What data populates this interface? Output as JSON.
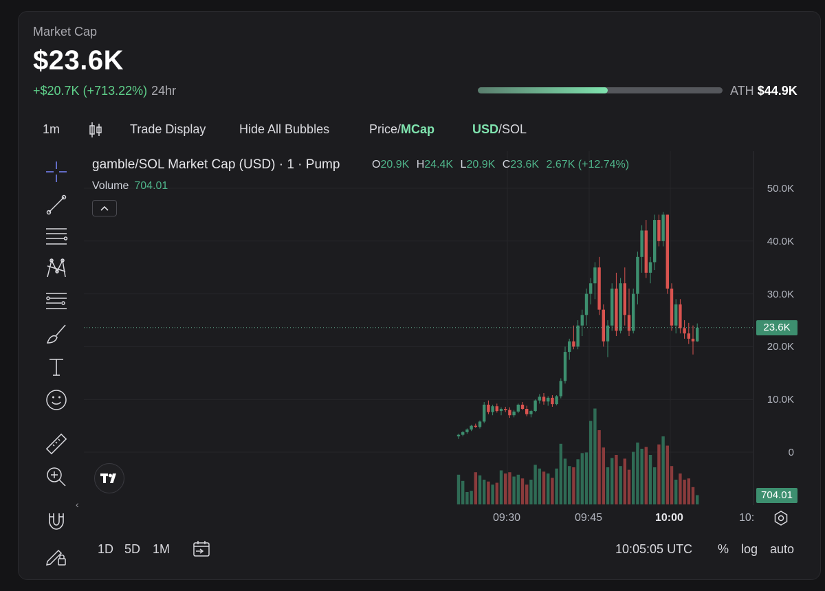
{
  "header": {
    "label": "Market Cap",
    "value": "$23.6K",
    "change": "+$20.7K (+713.22%)",
    "period": "24hr",
    "ath_label": "ATH",
    "ath_value": "$44.9K",
    "ath_progress": 0.53
  },
  "toolbar": {
    "interval": "1m",
    "trade_display": "Trade Display",
    "hide_bubbles": "Hide All Bubbles",
    "price_label": "Price/",
    "mcap_label": "MCap",
    "usd_label": "USD",
    "sol_label": "/SOL"
  },
  "legend": {
    "title": "gamble/SOL Market Cap (USD) · 1 · Pump",
    "o_key": "O",
    "o": "20.9K",
    "h_key": "H",
    "h": "24.4K",
    "l_key": "L",
    "l": "20.9K",
    "c_key": "C",
    "c": "23.6K",
    "change": "2.67K (+12.74%)",
    "volume_label": "Volume",
    "volume_value": "704.01"
  },
  "price_tag": "23.6K",
  "volume_tag": "704.01",
  "bottom": {
    "ranges": [
      "1D",
      "5D",
      "1M"
    ],
    "time": "10:05:05 UTC",
    "percent": "%",
    "log": "log",
    "auto": "auto"
  },
  "colors": {
    "up": "#3d8f6f",
    "down": "#d9534f",
    "up_vol": "#2f6b55",
    "down_vol": "#8a3b3c",
    "accent": "#7fe3ae"
  },
  "chart_data": {
    "type": "candlestick",
    "y_ticks": [
      "50.0K",
      "40.0K",
      "30.0K",
      "20.0K",
      "10.0K",
      "0"
    ],
    "x_ticks": [
      "09:30",
      "09:45",
      "10:00",
      "10:"
    ],
    "ylim": [
      0,
      50000
    ],
    "candles": [
      {
        "o": 3000,
        "h": 3500,
        "l": 2500,
        "c": 3300
      },
      {
        "o": 3300,
        "h": 4000,
        "l": 3000,
        "c": 3800
      },
      {
        "o": 3800,
        "h": 4500,
        "l": 3500,
        "c": 4300
      },
      {
        "o": 4300,
        "h": 5200,
        "l": 4000,
        "c": 5000
      },
      {
        "o": 5000,
        "h": 5400,
        "l": 4600,
        "c": 4800
      },
      {
        "o": 4800,
        "h": 6000,
        "l": 4500,
        "c": 5800
      },
      {
        "o": 5800,
        "h": 9500,
        "l": 5500,
        "c": 9000
      },
      {
        "o": 9000,
        "h": 9800,
        "l": 7200,
        "c": 7600
      },
      {
        "o": 7600,
        "h": 9000,
        "l": 7000,
        "c": 8700
      },
      {
        "o": 8700,
        "h": 9200,
        "l": 7500,
        "c": 7800
      },
      {
        "o": 7800,
        "h": 8500,
        "l": 7000,
        "c": 8200
      },
      {
        "o": 8200,
        "h": 8600,
        "l": 7600,
        "c": 8000
      },
      {
        "o": 8000,
        "h": 8500,
        "l": 6500,
        "c": 7000
      },
      {
        "o": 7000,
        "h": 8000,
        "l": 6600,
        "c": 7700
      },
      {
        "o": 7700,
        "h": 9200,
        "l": 7400,
        "c": 9000
      },
      {
        "o": 9000,
        "h": 9500,
        "l": 8000,
        "c": 8200
      },
      {
        "o": 8200,
        "h": 8800,
        "l": 6800,
        "c": 7200
      },
      {
        "o": 7200,
        "h": 8000,
        "l": 6600,
        "c": 7800
      },
      {
        "o": 7800,
        "h": 10000,
        "l": 7600,
        "c": 9800
      },
      {
        "o": 9800,
        "h": 11000,
        "l": 9200,
        "c": 10500
      },
      {
        "o": 10500,
        "h": 11200,
        "l": 9000,
        "c": 9600
      },
      {
        "o": 9600,
        "h": 10600,
        "l": 8800,
        "c": 10300
      },
      {
        "o": 10300,
        "h": 10800,
        "l": 8600,
        "c": 9100
      },
      {
        "o": 9100,
        "h": 10800,
        "l": 8900,
        "c": 10600
      },
      {
        "o": 10600,
        "h": 14000,
        "l": 10200,
        "c": 13500
      },
      {
        "o": 13500,
        "h": 20000,
        "l": 13000,
        "c": 19000
      },
      {
        "o": 19000,
        "h": 21500,
        "l": 17500,
        "c": 21000
      },
      {
        "o": 21000,
        "h": 24000,
        "l": 19500,
        "c": 20000
      },
      {
        "o": 20000,
        "h": 25000,
        "l": 19500,
        "c": 24000
      },
      {
        "o": 24000,
        "h": 27000,
        "l": 22000,
        "c": 26000
      },
      {
        "o": 26000,
        "h": 31000,
        "l": 24000,
        "c": 30000
      },
      {
        "o": 30000,
        "h": 33000,
        "l": 28000,
        "c": 32000
      },
      {
        "o": 32000,
        "h": 36000,
        "l": 29000,
        "c": 35000
      },
      {
        "o": 35000,
        "h": 37000,
        "l": 26000,
        "c": 27000
      },
      {
        "o": 27000,
        "h": 28000,
        "l": 20000,
        "c": 21000
      },
      {
        "o": 21000,
        "h": 25000,
        "l": 18000,
        "c": 24000
      },
      {
        "o": 24000,
        "h": 32000,
        "l": 23000,
        "c": 31000
      },
      {
        "o": 31000,
        "h": 34000,
        "l": 22000,
        "c": 23000
      },
      {
        "o": 23000,
        "h": 33000,
        "l": 22500,
        "c": 32000
      },
      {
        "o": 32000,
        "h": 35000,
        "l": 24000,
        "c": 26000
      },
      {
        "o": 26000,
        "h": 31000,
        "l": 22000,
        "c": 23000
      },
      {
        "o": 23000,
        "h": 31000,
        "l": 22500,
        "c": 30000
      },
      {
        "o": 30000,
        "h": 38000,
        "l": 28000,
        "c": 37000
      },
      {
        "o": 37000,
        "h": 43000,
        "l": 34000,
        "c": 42000
      },
      {
        "o": 42000,
        "h": 44000,
        "l": 33000,
        "c": 34000
      },
      {
        "o": 34000,
        "h": 37000,
        "l": 32000,
        "c": 36000
      },
      {
        "o": 36000,
        "h": 45000,
        "l": 34500,
        "c": 44000
      },
      {
        "o": 44000,
        "h": 45000,
        "l": 39000,
        "c": 40000
      },
      {
        "o": 40000,
        "h": 45500,
        "l": 39000,
        "c": 45000
      },
      {
        "o": 45000,
        "h": 45000,
        "l": 30000,
        "c": 31000
      },
      {
        "o": 31000,
        "h": 32000,
        "l": 23000,
        "c": 24000
      },
      {
        "o": 24000,
        "h": 29000,
        "l": 22500,
        "c": 28000
      },
      {
        "o": 28000,
        "h": 29000,
        "l": 22500,
        "c": 23500
      },
      {
        "o": 23500,
        "h": 25000,
        "l": 21500,
        "c": 22500
      },
      {
        "o": 22500,
        "h": 24500,
        "l": 20500,
        "c": 21500
      },
      {
        "o": 21500,
        "h": 24000,
        "l": 18500,
        "c": 21000
      },
      {
        "o": 21000,
        "h": 24400,
        "l": 20900,
        "c": 23600
      }
    ],
    "volumes": [
      0.48,
      0.38,
      0.2,
      0.22,
      0.52,
      0.47,
      0.4,
      0.37,
      0.32,
      0.35,
      0.55,
      0.5,
      0.52,
      0.45,
      0.48,
      0.42,
      0.32,
      0.4,
      0.64,
      0.58,
      0.53,
      0.5,
      0.43,
      0.58,
      0.98,
      0.74,
      0.62,
      0.6,
      0.73,
      0.83,
      0.84,
      1.35,
      1.55,
      1.2,
      0.92,
      0.6,
      0.75,
      0.8,
      0.62,
      0.74,
      0.56,
      0.85,
      1.0,
      0.9,
      0.93,
      0.8,
      0.6,
      0.97,
      1.1,
      0.95,
      0.62,
      0.4,
      0.5,
      0.4,
      0.42,
      0.28,
      0.15
    ]
  }
}
